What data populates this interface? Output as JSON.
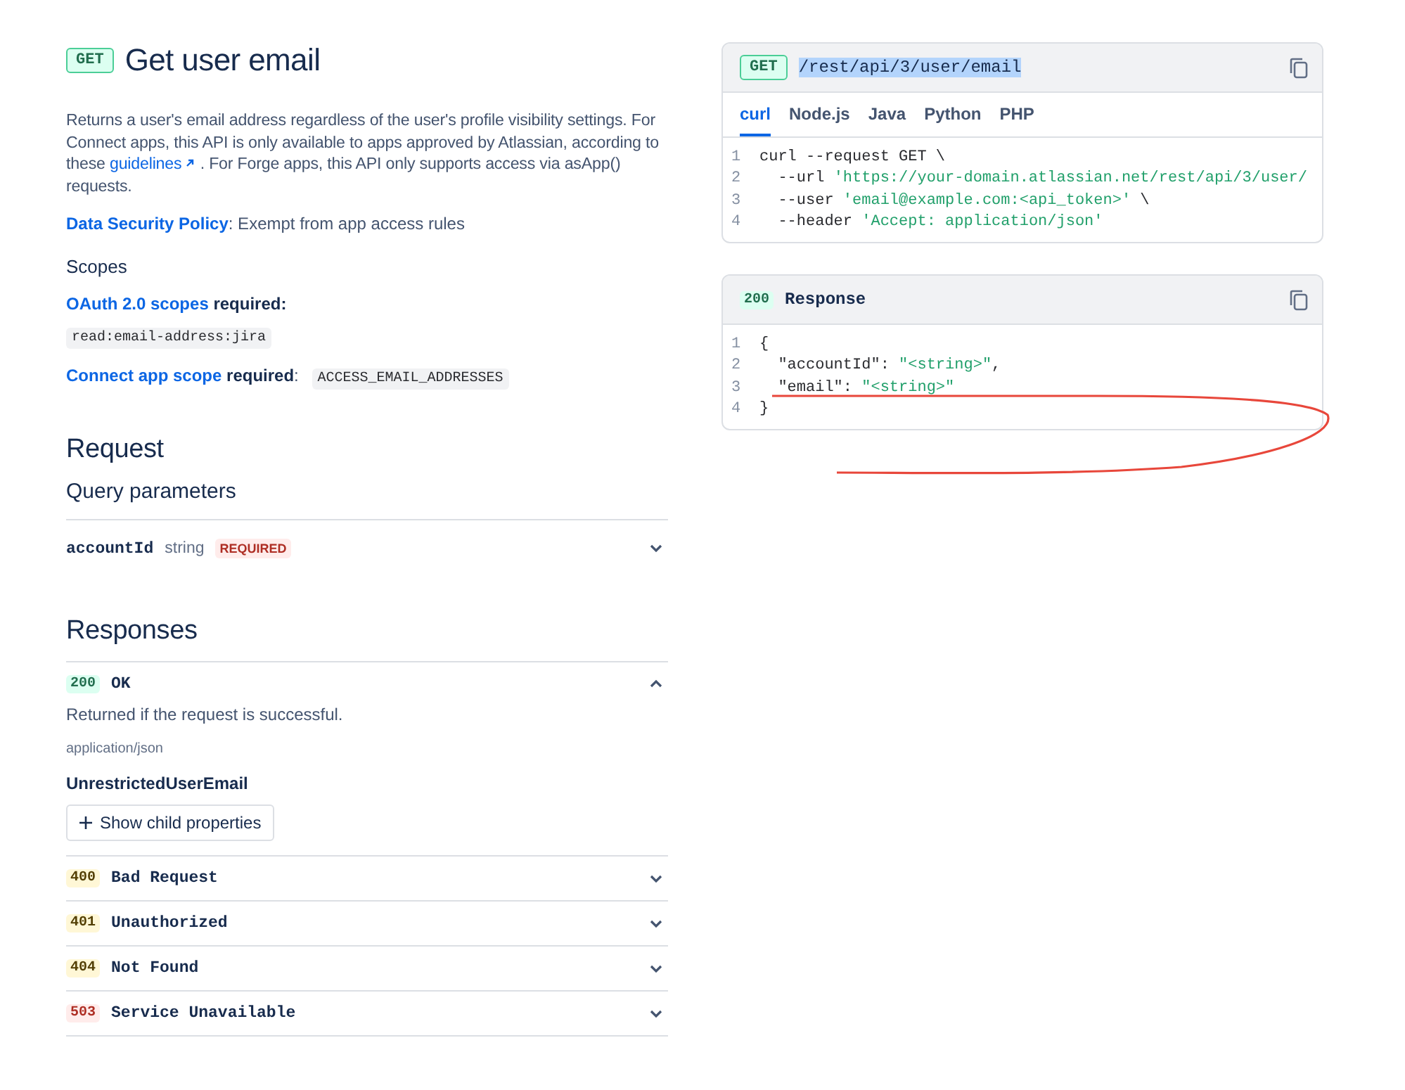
{
  "endpoint": {
    "method": "GET",
    "title": "Get user email"
  },
  "description": {
    "before": "Returns a user's email address regardless of the user's profile visibility settings. For Connect apps, this API is only available to apps approved by Atlassian, according to these ",
    "link": "guidelines",
    "after": " . For Forge apps, this API only supports access via asApp() requests."
  },
  "data_security": {
    "link": "Data Security Policy",
    "text": ": Exempt from app access rules"
  },
  "scopes": {
    "heading": "Scopes",
    "oauth_link": "OAuth 2.0 scopes",
    "oauth_text": " required:",
    "oauth_scope": "read:email-address:jira",
    "connect_link": "Connect app scope",
    "connect_text": " required",
    "connect_colon": ":",
    "connect_scope": "ACCESS_EMAIL_ADDRESSES"
  },
  "request": {
    "heading": "Request",
    "query_heading": "Query parameters",
    "params": [
      {
        "name": "accountId",
        "type": "string",
        "badge": "REQUIRED",
        "expanded": false
      }
    ]
  },
  "responses": {
    "heading": "Responses",
    "items": [
      {
        "code": "200",
        "label": "OK",
        "kind": "success",
        "expanded": true,
        "description": "Returned if the request is successful.",
        "media_type": "application/json",
        "schema": "UnrestrictedUserEmail",
        "button": "Show child properties"
      },
      {
        "code": "400",
        "label": "Bad Request",
        "kind": "warning",
        "expanded": false
      },
      {
        "code": "401",
        "label": "Unauthorized",
        "kind": "warning",
        "expanded": false
      },
      {
        "code": "404",
        "label": "Not Found",
        "kind": "warning",
        "expanded": false
      },
      {
        "code": "503",
        "label": "Service Unavailable",
        "kind": "error",
        "expanded": false
      }
    ]
  },
  "request_panel": {
    "method": "GET",
    "path": "/rest/api/3/user/email",
    "path_highlighted": true,
    "tabs": [
      {
        "label": "curl",
        "selected": true
      },
      {
        "label": "Node.js",
        "selected": false
      },
      {
        "label": "Java",
        "selected": false
      },
      {
        "label": "Python",
        "selected": false
      },
      {
        "label": "PHP",
        "selected": false
      }
    ],
    "lines": [
      {
        "number": "1",
        "segments": [
          {
            "kind": "plain",
            "text": "curl --request GET \\"
          }
        ]
      },
      {
        "number": "2",
        "segments": [
          {
            "kind": "plain",
            "text": "  --url "
          },
          {
            "kind": "string",
            "text": "'https://your-domain.atlassian.net/rest/api/3/user/"
          }
        ]
      },
      {
        "number": "3",
        "segments": [
          {
            "kind": "plain",
            "text": "  --user "
          },
          {
            "kind": "string",
            "text": "'email@example.com:<api_token>'"
          },
          {
            "kind": "plain",
            "text": " \\"
          }
        ]
      },
      {
        "number": "4",
        "segments": [
          {
            "kind": "plain",
            "text": "  --header "
          },
          {
            "kind": "string",
            "text": "'Accept: application/json'"
          }
        ]
      }
    ]
  },
  "response_panel": {
    "code": "200",
    "title": "Response",
    "lines": [
      {
        "number": "1",
        "segments": [
          {
            "kind": "plain",
            "text": "{"
          }
        ]
      },
      {
        "number": "2",
        "segments": [
          {
            "kind": "plain",
            "text": "  \"accountId\": "
          },
          {
            "kind": "string",
            "text": "\"<string>\""
          },
          {
            "kind": "plain",
            "text": ","
          }
        ]
      },
      {
        "number": "3",
        "segments": [
          {
            "kind": "plain",
            "text": "  \"email\": "
          },
          {
            "kind": "string",
            "text": "\"<string>\""
          }
        ]
      },
      {
        "number": "4",
        "segments": [
          {
            "kind": "plain",
            "text": "}"
          }
        ]
      }
    ]
  }
}
